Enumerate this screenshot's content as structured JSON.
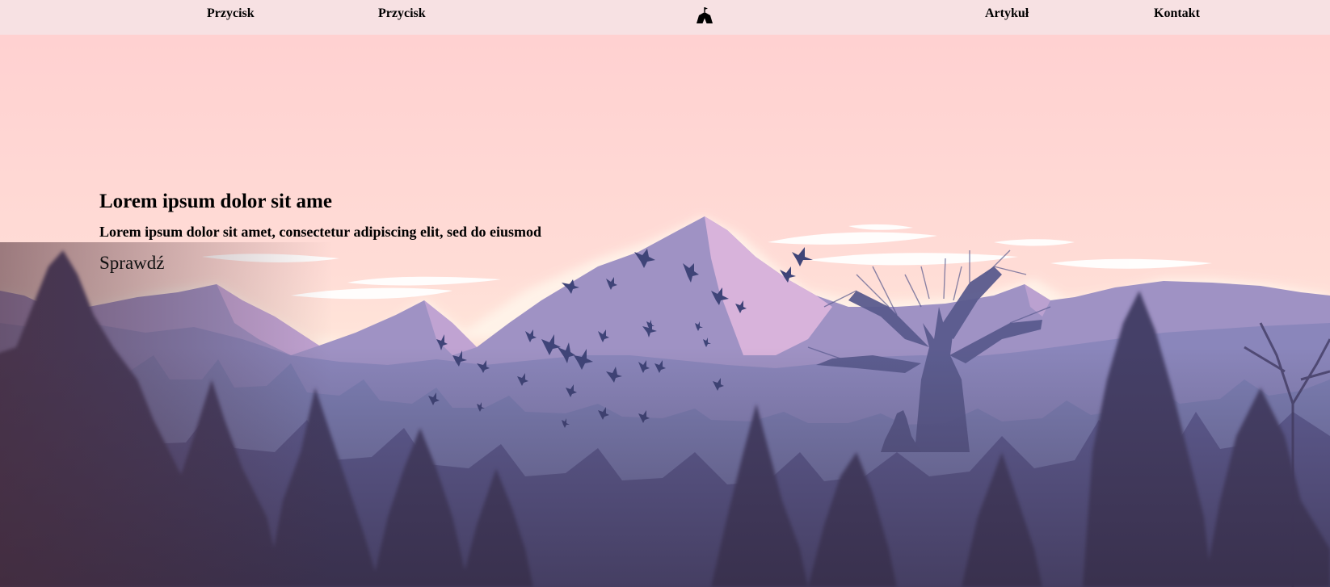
{
  "nav": {
    "items": [
      {
        "label": "Przycisk"
      },
      {
        "label": "Przycisk"
      },
      {
        "label": "Artykuł"
      },
      {
        "label": "Kontakt"
      }
    ],
    "logo_icon": "tent-flag-icon"
  },
  "hero": {
    "title": "Lorem ipsum dolor sit ame",
    "subtitle": "Lorem ipsum dolor sit amet, consectetur adipiscing elit, sed do eiusmod",
    "cta_label": "Sprawdź"
  },
  "colors": {
    "sky_top": "#ffd2d2",
    "sky_horizon": "#ffe3d8",
    "mountain_far": "#9f92c4",
    "mountain_peak_highlight": "#d9b4dc",
    "forest_mid": "#7c7fb4",
    "forest_dark": "#4a4575",
    "foreground": "#3a2f4a",
    "nav_background": "#f6e2e4"
  }
}
